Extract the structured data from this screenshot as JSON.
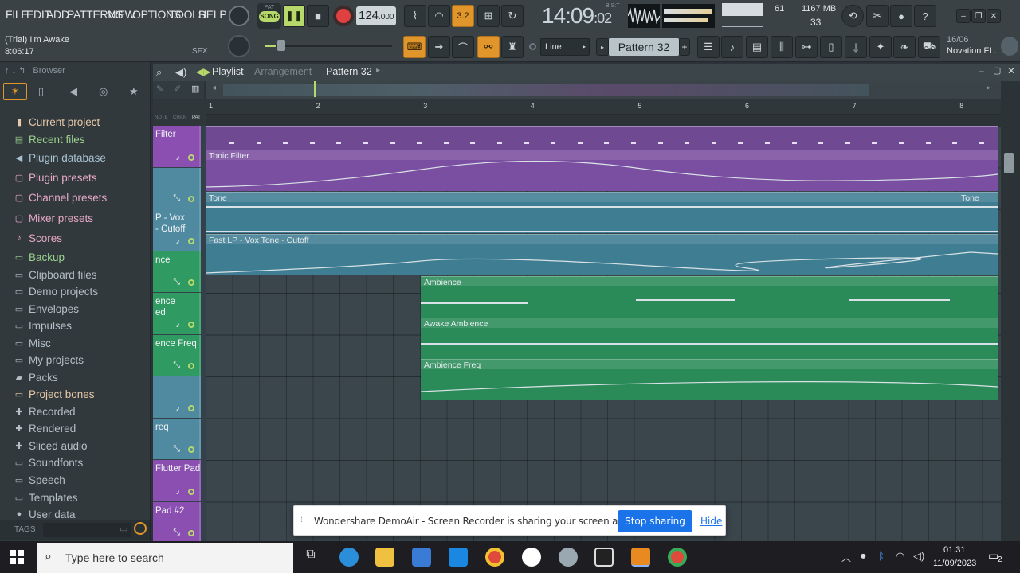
{
  "menu": [
    "FILE",
    "EDIT",
    "ADD",
    "PATTERNS",
    "VIEW",
    "OPTIONS",
    "TOOLS",
    "HELP"
  ],
  "transport": {
    "pat": "PAT",
    "song": "SONG",
    "tempo": "124",
    "tempo_frac": ".000",
    "time_main": "14:09",
    "time_frac": "02",
    "bst": "B:S:T"
  },
  "project": {
    "title": "(Trial) I'm Awake",
    "time": "8:06:17",
    "sfx": "SFX"
  },
  "monitor": {
    "cpu": "61",
    "mem": "1167 MB",
    "poly": "33",
    "midi_ver": "16/06",
    "midi_device": "Novation FL."
  },
  "toolbar2": {
    "snap": "Line",
    "pattern": "Pattern 32"
  },
  "browser": {
    "header": "Browser",
    "tags": "TAGS",
    "items": [
      {
        "label": "Current project",
        "icon": "project-icon",
        "color": "#e7c8a8"
      },
      {
        "label": "Recent files",
        "icon": "recent-icon",
        "color": "#9bd28e"
      },
      {
        "label": "Plugin database",
        "icon": "plugin-icon",
        "color": "#a9c3d2"
      },
      {
        "label": "Plugin presets",
        "icon": "preset-icon",
        "color": "#e6a9c4"
      },
      {
        "label": "Channel presets",
        "icon": "preset-icon",
        "color": "#e6a9c4"
      },
      {
        "label": "Mixer presets",
        "icon": "preset-icon",
        "color": "#e6a9c4"
      },
      {
        "label": "Scores",
        "icon": "note-icon",
        "color": "#e6a9c4"
      },
      {
        "label": "Backup",
        "icon": "folder-icon",
        "color": "#9bd28e"
      },
      {
        "label": "Clipboard files",
        "icon": "folder-icon",
        "color": "#b4c0c6"
      },
      {
        "label": "Demo projects",
        "icon": "folder-icon",
        "color": "#b4c0c6"
      },
      {
        "label": "Envelopes",
        "icon": "folder-icon",
        "color": "#b4c0c6"
      },
      {
        "label": "Impulses",
        "icon": "folder-icon",
        "color": "#b4c0c6"
      },
      {
        "label": "Misc",
        "icon": "folder-icon",
        "color": "#b4c0c6"
      },
      {
        "label": "My projects",
        "icon": "folder-icon",
        "color": "#b4c0c6"
      },
      {
        "label": "Packs",
        "icon": "pack-icon",
        "color": "#b4c0c6"
      },
      {
        "label": "Project bones",
        "icon": "folder-icon",
        "color": "#e7c8a8"
      },
      {
        "label": "Recorded",
        "icon": "plus-icon",
        "color": "#b4c0c6"
      },
      {
        "label": "Rendered",
        "icon": "plus-icon",
        "color": "#b4c0c6"
      },
      {
        "label": "Sliced audio",
        "icon": "plus-icon",
        "color": "#b4c0c6"
      },
      {
        "label": "Soundfonts",
        "icon": "folder-icon",
        "color": "#b4c0c6"
      },
      {
        "label": "Speech",
        "icon": "folder-icon",
        "color": "#b4c0c6"
      },
      {
        "label": "Templates",
        "icon": "folder-icon",
        "color": "#b4c0c6"
      },
      {
        "label": "User data",
        "icon": "user-icon",
        "color": "#b4c0c6"
      }
    ]
  },
  "playlist": {
    "title": "Playlist",
    "sep": " - ",
    "mode": "Arrangement",
    "pattern": "Pattern 32",
    "bars": [
      "1",
      "2",
      "3",
      "4",
      "5",
      "6",
      "7",
      "8"
    ],
    "hdr_labels": [
      "PAT",
      "CHAN",
      "NOTE"
    ],
    "tracks": [
      {
        "name": "Filter",
        "color": "#8a4fb0"
      },
      {
        "name": "",
        "color": "#4f8aa0"
      },
      {
        "name": "P - Vox\n- Cutoff",
        "color": "#4f8aa0"
      },
      {
        "name": "nce",
        "color": "#2f9a62"
      },
      {
        "name": "ence\ned",
        "color": "#2f9a62"
      },
      {
        "name": "ence Freq",
        "color": "#2f9a62"
      },
      {
        "name": "",
        "color": "#4f8aa0"
      },
      {
        "name": "req",
        "color": "#4f8aa0"
      },
      {
        "name": "Flutter Pad",
        "color": "#8a4fb0"
      },
      {
        "name": "Pad #2",
        "color": "#8a4fb0"
      }
    ],
    "clips": [
      {
        "name": "Tonic Filter"
      },
      {
        "name": "Tone"
      },
      {
        "name": "Tone"
      },
      {
        "name": "Fast LP - Vox Tone - Cutoff"
      },
      {
        "name": "Ambience"
      },
      {
        "name": "Awake Ambience"
      },
      {
        "name": "Ambience Freq"
      }
    ]
  },
  "notice": {
    "text": "Wondershare DemoAir - Screen Recorder is sharing your screen and audio.",
    "stop": "Stop sharing",
    "hide": "Hide"
  },
  "taskbar": {
    "search": "Type here to search",
    "time": "01:31",
    "date": "11/09/2023",
    "notif": "2"
  }
}
